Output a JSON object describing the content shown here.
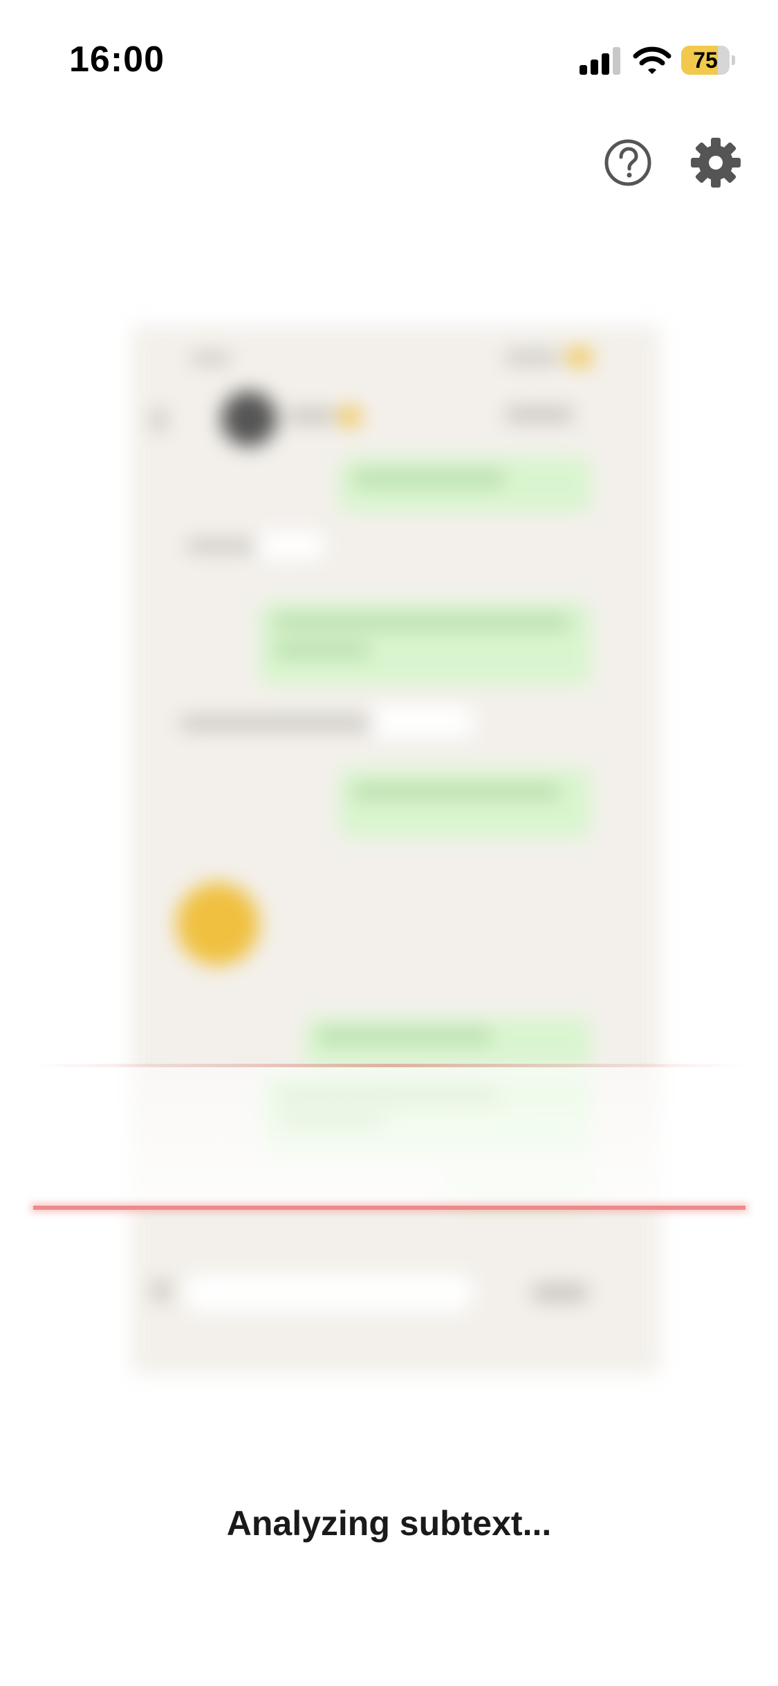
{
  "status_bar": {
    "time": "16:00",
    "battery_level": 75,
    "battery_label": "75",
    "signal_bars": 3,
    "icons": [
      "cellular-signal-icon",
      "wifi-icon",
      "battery-icon"
    ]
  },
  "toolbar": {
    "help_icon": "question-circle-icon",
    "settings_icon": "gear-icon"
  },
  "preview": {
    "description_icon": "blurred-chat-screenshot"
  },
  "colors": {
    "battery_fill": "#f2c94c",
    "scan_line": "#ef8a8a",
    "icon_gray": "#555555",
    "bubble_green": "#d9f5cf",
    "chat_background": "#f3f0eb"
  },
  "status": {
    "message": "Analyzing subtext..."
  }
}
